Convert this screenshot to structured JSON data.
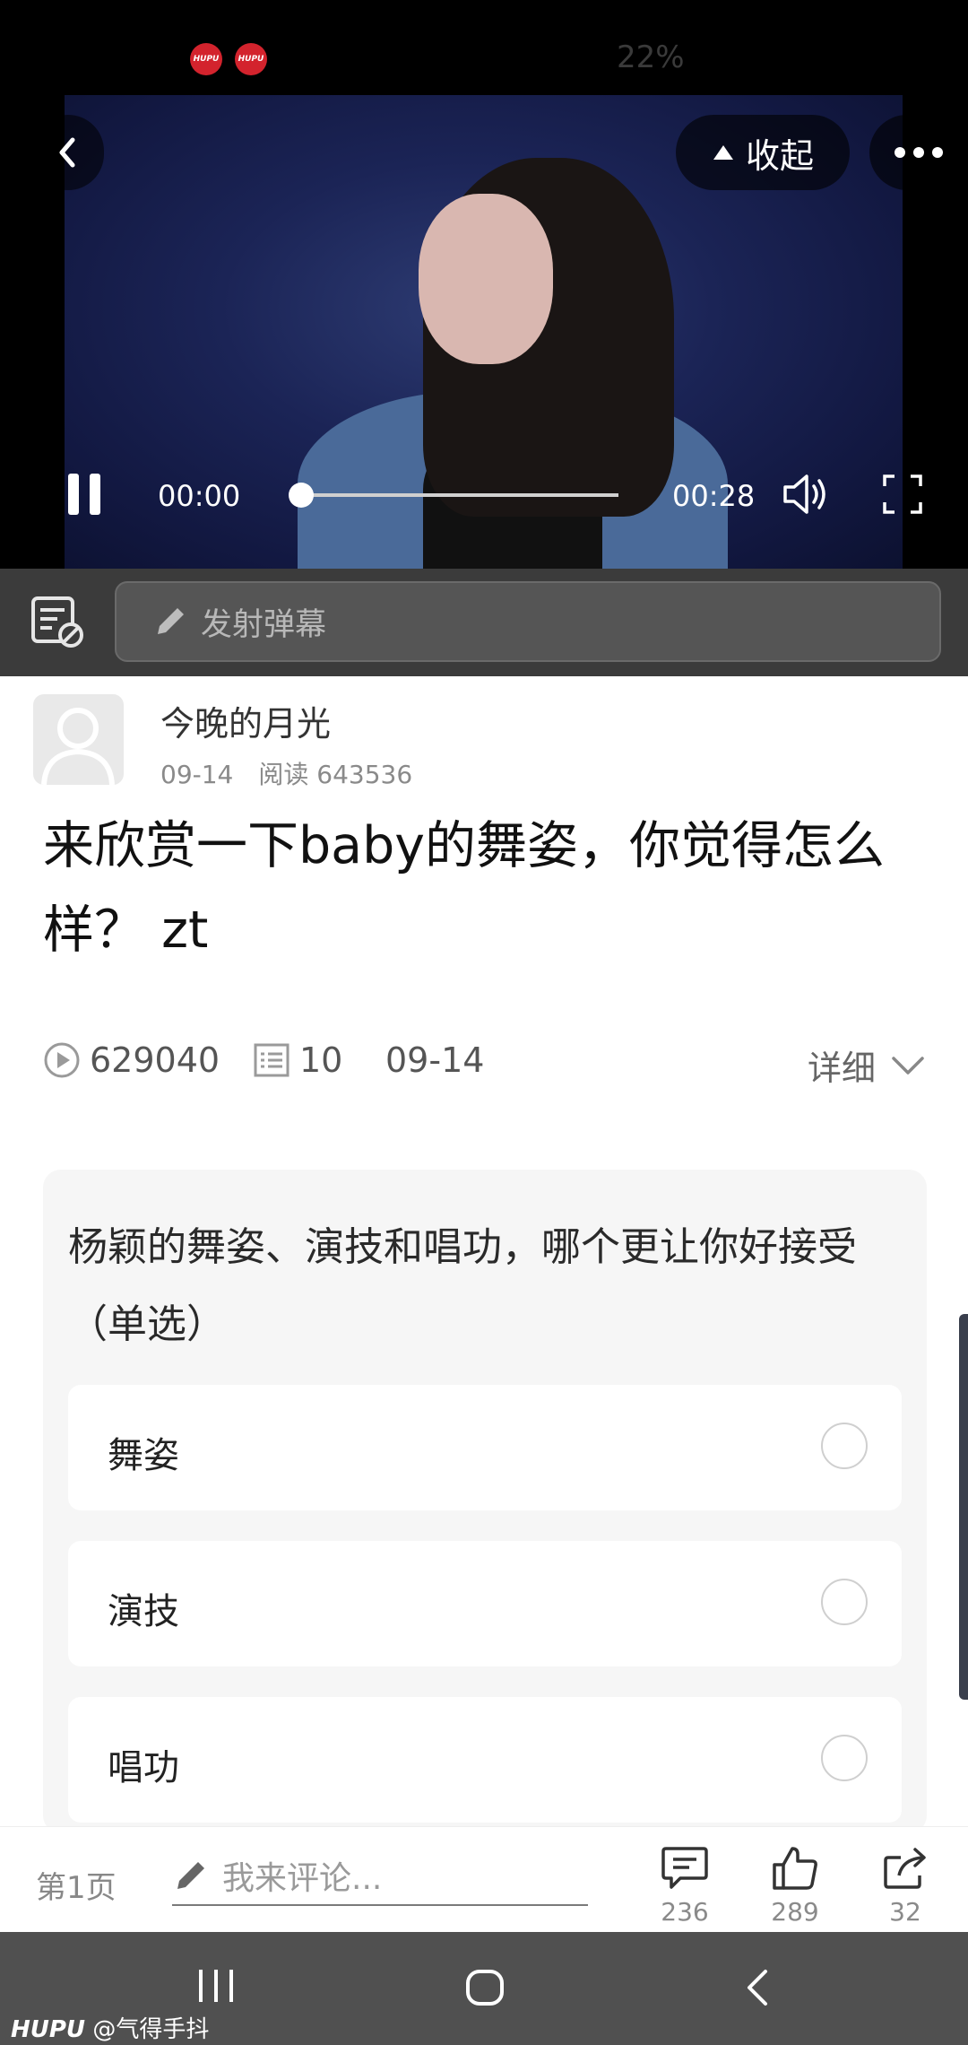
{
  "status_bar": {
    "app_badges": [
      "HUPU",
      "HUPU"
    ],
    "battery": "22%"
  },
  "video": {
    "collapse_label": "收起",
    "current_time": "00:00",
    "duration": "00:28",
    "progress_fraction": 0.0
  },
  "danmaku": {
    "placeholder": "发射弹幕"
  },
  "post": {
    "author": "今晚的月光",
    "date": "09-14",
    "reads": "阅读 643536",
    "title": "来欣赏一下baby的舞姿，你觉得怎么样？ zt",
    "play_count": "629040",
    "list_count": "10",
    "stat_date": "09-14",
    "detail_label": "详细"
  },
  "poll": {
    "question": "杨颖的舞姿、演技和唱功，哪个更让你好接受（单选）",
    "options": [
      {
        "label": "舞姿"
      },
      {
        "label": "演技"
      },
      {
        "label": "唱功"
      }
    ]
  },
  "comment_bar": {
    "page_label": "第1页",
    "placeholder": "我来评论...",
    "comments": "236",
    "likes": "289",
    "shares": "32"
  },
  "watermark": {
    "brand": "HUPU",
    "handle": "@气得手抖"
  },
  "colors": {
    "hupu_red": "#d3232d",
    "video_bg": "#1b2456",
    "danmaku_bar": "#3b3b3b",
    "nav_bar": "#505050"
  }
}
